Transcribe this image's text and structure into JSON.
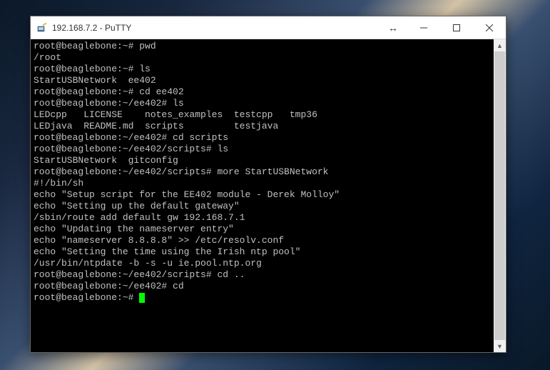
{
  "window": {
    "title": "192.168.7.2 - PuTTY"
  },
  "terminal": {
    "lines": [
      "root@beaglebone:~# pwd",
      "/root",
      "root@beaglebone:~# ls",
      "StartUSBNetwork  ee402",
      "root@beaglebone:~# cd ee402",
      "root@beaglebone:~/ee402# ls",
      "LEDcpp   LICENSE    notes_examples  testcpp   tmp36",
      "LEDjava  README.md  scripts         testjava",
      "root@beaglebone:~/ee402# cd scripts",
      "root@beaglebone:~/ee402/scripts# ls",
      "StartUSBNetwork  gitconfig",
      "root@beaglebone:~/ee402/scripts# more StartUSBNetwork",
      "#!/bin/sh",
      "echo \"Setup script for the EE402 module - Derek Molloy\"",
      "echo \"Setting up the default gateway\"",
      "/sbin/route add default gw 192.168.7.1",
      "",
      "echo \"Updating the nameserver entry\"",
      "echo \"nameserver 8.8.8.8\" >> /etc/resolv.conf",
      "",
      "echo \"Setting the time using the Irish ntp pool\"",
      "/usr/bin/ntpdate -b -s -u ie.pool.ntp.org",
      "root@beaglebone:~/ee402/scripts# cd ..",
      "root@beaglebone:~/ee402# cd",
      "root@beaglebone:~# "
    ]
  }
}
